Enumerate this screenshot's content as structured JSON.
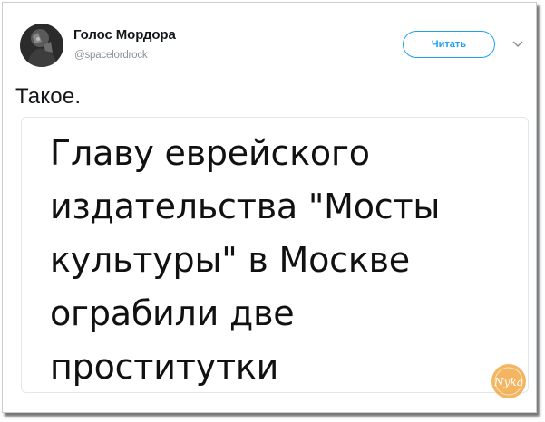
{
  "tweet": {
    "author": {
      "name": "Голос Мордора",
      "handle": "@spacelordrock"
    },
    "follow_button_label": "Читать",
    "text": "Такое.",
    "image_text_lines": [
      "Главу еврейского",
      "издательства \"Мосты",
      "культуры\" в Москве",
      "ограбили две",
      "проститутки"
    ]
  },
  "watermark": {
    "text": "Nyka",
    "icon": "watermark-logo"
  },
  "colors": {
    "accent": "#1da1f2",
    "text": "#14171a",
    "secondary_text": "#8a9299",
    "watermark": "#f0a23a"
  }
}
